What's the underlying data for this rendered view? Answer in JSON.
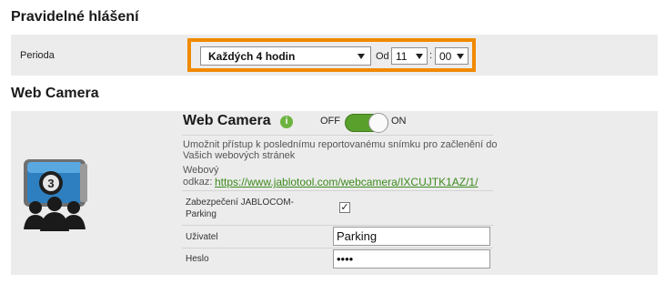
{
  "section1": {
    "title": "Pravidelné hlášení",
    "period_label": "Perioda",
    "period_value": "Každých 4 hodin",
    "from_label": "Od",
    "hour_value": "11",
    "colon": ":",
    "minute_value": "00"
  },
  "section2": {
    "title": "Web Camera",
    "card_title": "Web Camera",
    "info_glyph": "i",
    "toggle": {
      "off_label": "OFF",
      "on_label": "ON",
      "state": "on"
    },
    "description_line1": "Umožnit přístup k poslednímu reportovanému snímku pro začlenění do",
    "description_line2": "Vašich webových stránek",
    "link_label_line1": "Webový",
    "link_label_line2": "odkaz:",
    "link_url": "https://www.jablotool.com/webcamera/IXCUJTK1AZ/1/",
    "security_label_line1": "Zabezpečení JABLOCOM-",
    "security_label_line2": "Parking",
    "security_checked": "✓",
    "user_label": "Uživatel",
    "user_value": "Parking",
    "password_label": "Heslo",
    "password_value": "••••",
    "camera_badge": "3"
  },
  "colors": {
    "accent_orange": "#f08a00",
    "toggle_green": "#5aa02c",
    "link_green": "#3c8a1c",
    "band_gray": "#ececec"
  },
  "icons": [
    "webcam-group-icon",
    "info-icon",
    "chevron-down-icon",
    "checkmark-icon"
  ]
}
